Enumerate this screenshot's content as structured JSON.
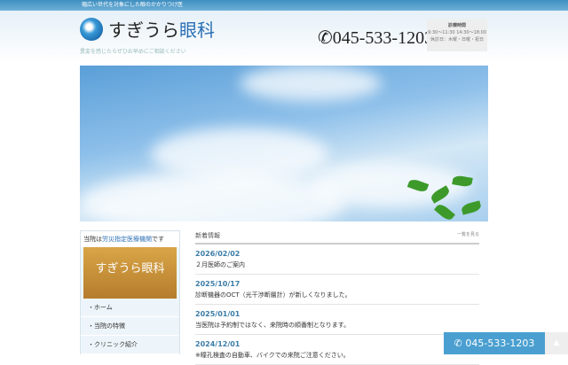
{
  "topbar": {
    "tagline": "幅広い世代を対象にした眼のかかりつけ医"
  },
  "header": {
    "logo_main": "すぎうら",
    "logo_accent": "眼科",
    "subtitle": "異変を感じたらぜひお早めにご相談ください",
    "phone": "045-533-1203",
    "hours": {
      "title": "診療時間",
      "times": "9:30〜11:30 14:30〜18:00",
      "closed": "休診日：木曜・日曜・祝日"
    }
  },
  "sidebar": {
    "badge_pre": "当院は",
    "badge_accent": "労災指定医療機関",
    "badge_post": "です",
    "photo_text": "すぎうら眼科",
    "nav": [
      "ホーム",
      "当院の特徴",
      "クリニック紹介"
    ]
  },
  "news": {
    "title": "新着情報",
    "more": "一覧を見る",
    "items": [
      {
        "date": "2026/02/02",
        "text": "２月医師のご案内"
      },
      {
        "date": "2025/10/17",
        "text": "診断機器のOCT（光干渉断層計）が新しくなりました。"
      },
      {
        "date": "2025/01/01",
        "text": "当医院は予約制ではなく、来院時の順番制となります。"
      },
      {
        "date": "2024/12/01",
        "text": "※瞳孔検査の自動車、バイクでの来院ご注意ください。"
      }
    ]
  },
  "float": {
    "phone": "045-533-1203",
    "top": "▲"
  }
}
